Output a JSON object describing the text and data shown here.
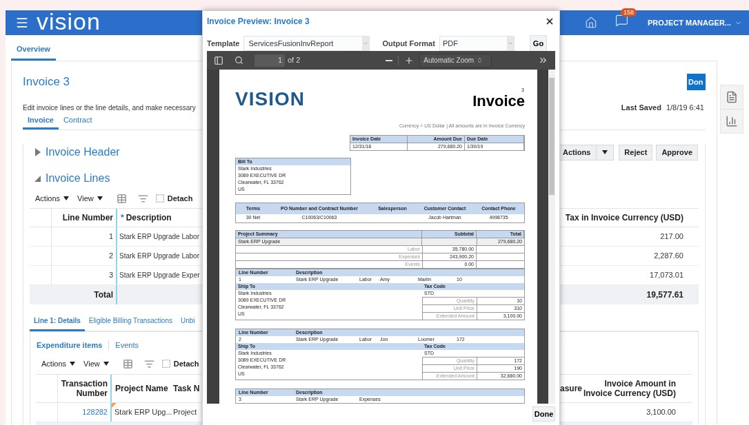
{
  "header": {
    "logo": "vision",
    "notification_count": "158",
    "user_menu": "PROJECT MANAGER..."
  },
  "page_tabs": [
    {
      "label": "Overview",
      "selected": true
    }
  ],
  "page": {
    "title": "Invoice 3",
    "done_button": "Don",
    "instructions": "Edit invoice lines or the line details, and make necessary",
    "last_saved_label": "Last Saved",
    "last_saved_value": "1/8/19 6:41"
  },
  "tabs": [
    {
      "label": "Invoice",
      "selected": true
    },
    {
      "label": "Contract",
      "selected": false
    }
  ],
  "invoice_header": {
    "title": "Invoice Header",
    "expanded": false,
    "buttons": [
      {
        "label": "Actions",
        "kind": "split"
      },
      {
        "label": "Reject",
        "kind": "plain"
      },
      {
        "label": "Approve",
        "kind": "plain"
      }
    ]
  },
  "invoice_lines": {
    "title": "Invoice Lines",
    "expanded": true,
    "toolbar": {
      "actions": "Actions",
      "view": "View",
      "detach": "Detach"
    },
    "columns": [
      {
        "label": "Line Number"
      },
      {
        "label": "Description",
        "required_mark": "*"
      },
      {
        "label": "Tax in Invoice Currency (USD)"
      }
    ],
    "rows": [
      {
        "line_number": "1",
        "description": "Stark ERP Upgrade Labor",
        "tax": "217.00"
      },
      {
        "line_number": "2",
        "description": "Stark ERP Upgrade Labor",
        "tax": "2,287.60"
      },
      {
        "line_number": "3",
        "description": "Stark ERP Upgrade Exper",
        "tax": "17,073.01"
      }
    ],
    "total": {
      "label": "Total",
      "tax": "19,577.61"
    }
  },
  "line_tabs": [
    {
      "label": "Line 1: Details",
      "selected": true
    },
    {
      "label": "Eligible Billing Transactions",
      "selected": false
    },
    {
      "label": "Unbi",
      "selected": false
    }
  ],
  "detail_tabs": [
    {
      "label": "Expenditure items",
      "selected": true
    },
    {
      "label": "Events",
      "selected": false
    }
  ],
  "details_toolbar": {
    "actions": "Actions",
    "view": "View",
    "detach": "Detach"
  },
  "details_table": {
    "columns": [
      "Transaction Number",
      "Project Name",
      "Task N",
      "asure",
      "Invoice Amount in Invoice Currency (USD)"
    ],
    "rows": [
      {
        "transaction_number": "128282",
        "project_name": "Stark ERP Upg...",
        "task": "Project",
        "amount": "3,100.00",
        "modified": true
      }
    ]
  },
  "dialog": {
    "title": "Invoice Preview: Invoice 3",
    "template_label": "Template",
    "template_value": "ServicesFusionInvReport",
    "format_label": "Output Format",
    "format_value": "PDF",
    "go_button": "Go",
    "done_button": "Done",
    "viewer": {
      "page_number": "1",
      "page_count": "of 2",
      "zoom": "Automatic Zoom"
    },
    "document": {
      "logo": "VISION",
      "invoice_number": "3",
      "title": "Invoice",
      "currency_note": "Currency = US Dollar | All amounts are in Invoice Currency",
      "dates": [
        {
          "label": "Invoice Date",
          "value": "12/31/18"
        },
        {
          "label": "Amount Due",
          "value": "279,680.20"
        },
        {
          "label": "Due Date",
          "value": "1/30/19"
        }
      ],
      "bill_to": {
        "label": "Bill To",
        "lines": [
          "Stark Industries",
          "3089 EXECUTIVE DR",
          "Clearwater, FL 33762",
          "US"
        ]
      },
      "terms": [
        {
          "label": "Terms",
          "value": "30 Net"
        },
        {
          "label": "PO Number and Contract Number",
          "value": "C10063/C10063"
        },
        {
          "label": "Salesperson"
        },
        {
          "label": "Customer Contact",
          "value": "Jacob Hartman"
        },
        {
          "label": "Contact Phone",
          "value": "4998735"
        }
      ],
      "project_summary": {
        "columns": [
          "Project Summary",
          "Subtotal",
          "Total"
        ],
        "project": "Stark ERP Upgrade",
        "total": "279,680.20",
        "items": [
          {
            "label": "Labor",
            "subtotal": "35,780.00"
          },
          {
            "label": "Expenses",
            "subtotal": "243,900.20"
          },
          {
            "label": "Events",
            "subtotal": "0.00"
          }
        ]
      },
      "lines": [
        {
          "line_label": "Line Number",
          "description_label": "Description",
          "fields": [
            "1",
            "Stark ERP Upgrade",
            "Labor",
            "Amy",
            "Marlin",
            "10"
          ],
          "ship_to_label": "Ship To",
          "tax_code_label": "Tax Code",
          "ship_to": [
            "Stark Industries",
            "3089 EXECUTIVE DR",
            "Clearwater, FL 33762",
            "US"
          ],
          "tax_code": "STD",
          "amounts": [
            {
              "label": "Quantity",
              "value": "10"
            },
            {
              "label": "Unit Price",
              "value": "310"
            },
            {
              "label": "Extended Amount",
              "value": "3,100.00"
            }
          ]
        },
        {
          "line_label": "Line Number",
          "description_label": "Description",
          "fields": [
            "2",
            "Stark ERP Upgrade",
            "Labor",
            "Jon",
            "Loomer",
            "172"
          ],
          "ship_to_label": "Ship To",
          "tax_code_label": "Tax Code",
          "ship_to": [
            "Stark Industries",
            "3089 EXECUTIVE DR",
            "Clearwater, FL 33762",
            "US"
          ],
          "tax_code": "STD",
          "amounts": [
            {
              "label": "Quantity",
              "value": "172"
            },
            {
              "label": "Unit Price",
              "value": "190"
            },
            {
              "label": "Extended Amount",
              "value": "32,680.00"
            }
          ]
        },
        {
          "line_label": "Line Number",
          "description_label": "Description",
          "fields": [
            "3",
            "Stark ERP Upgrade",
            "Expenses"
          ]
        }
      ]
    }
  }
}
